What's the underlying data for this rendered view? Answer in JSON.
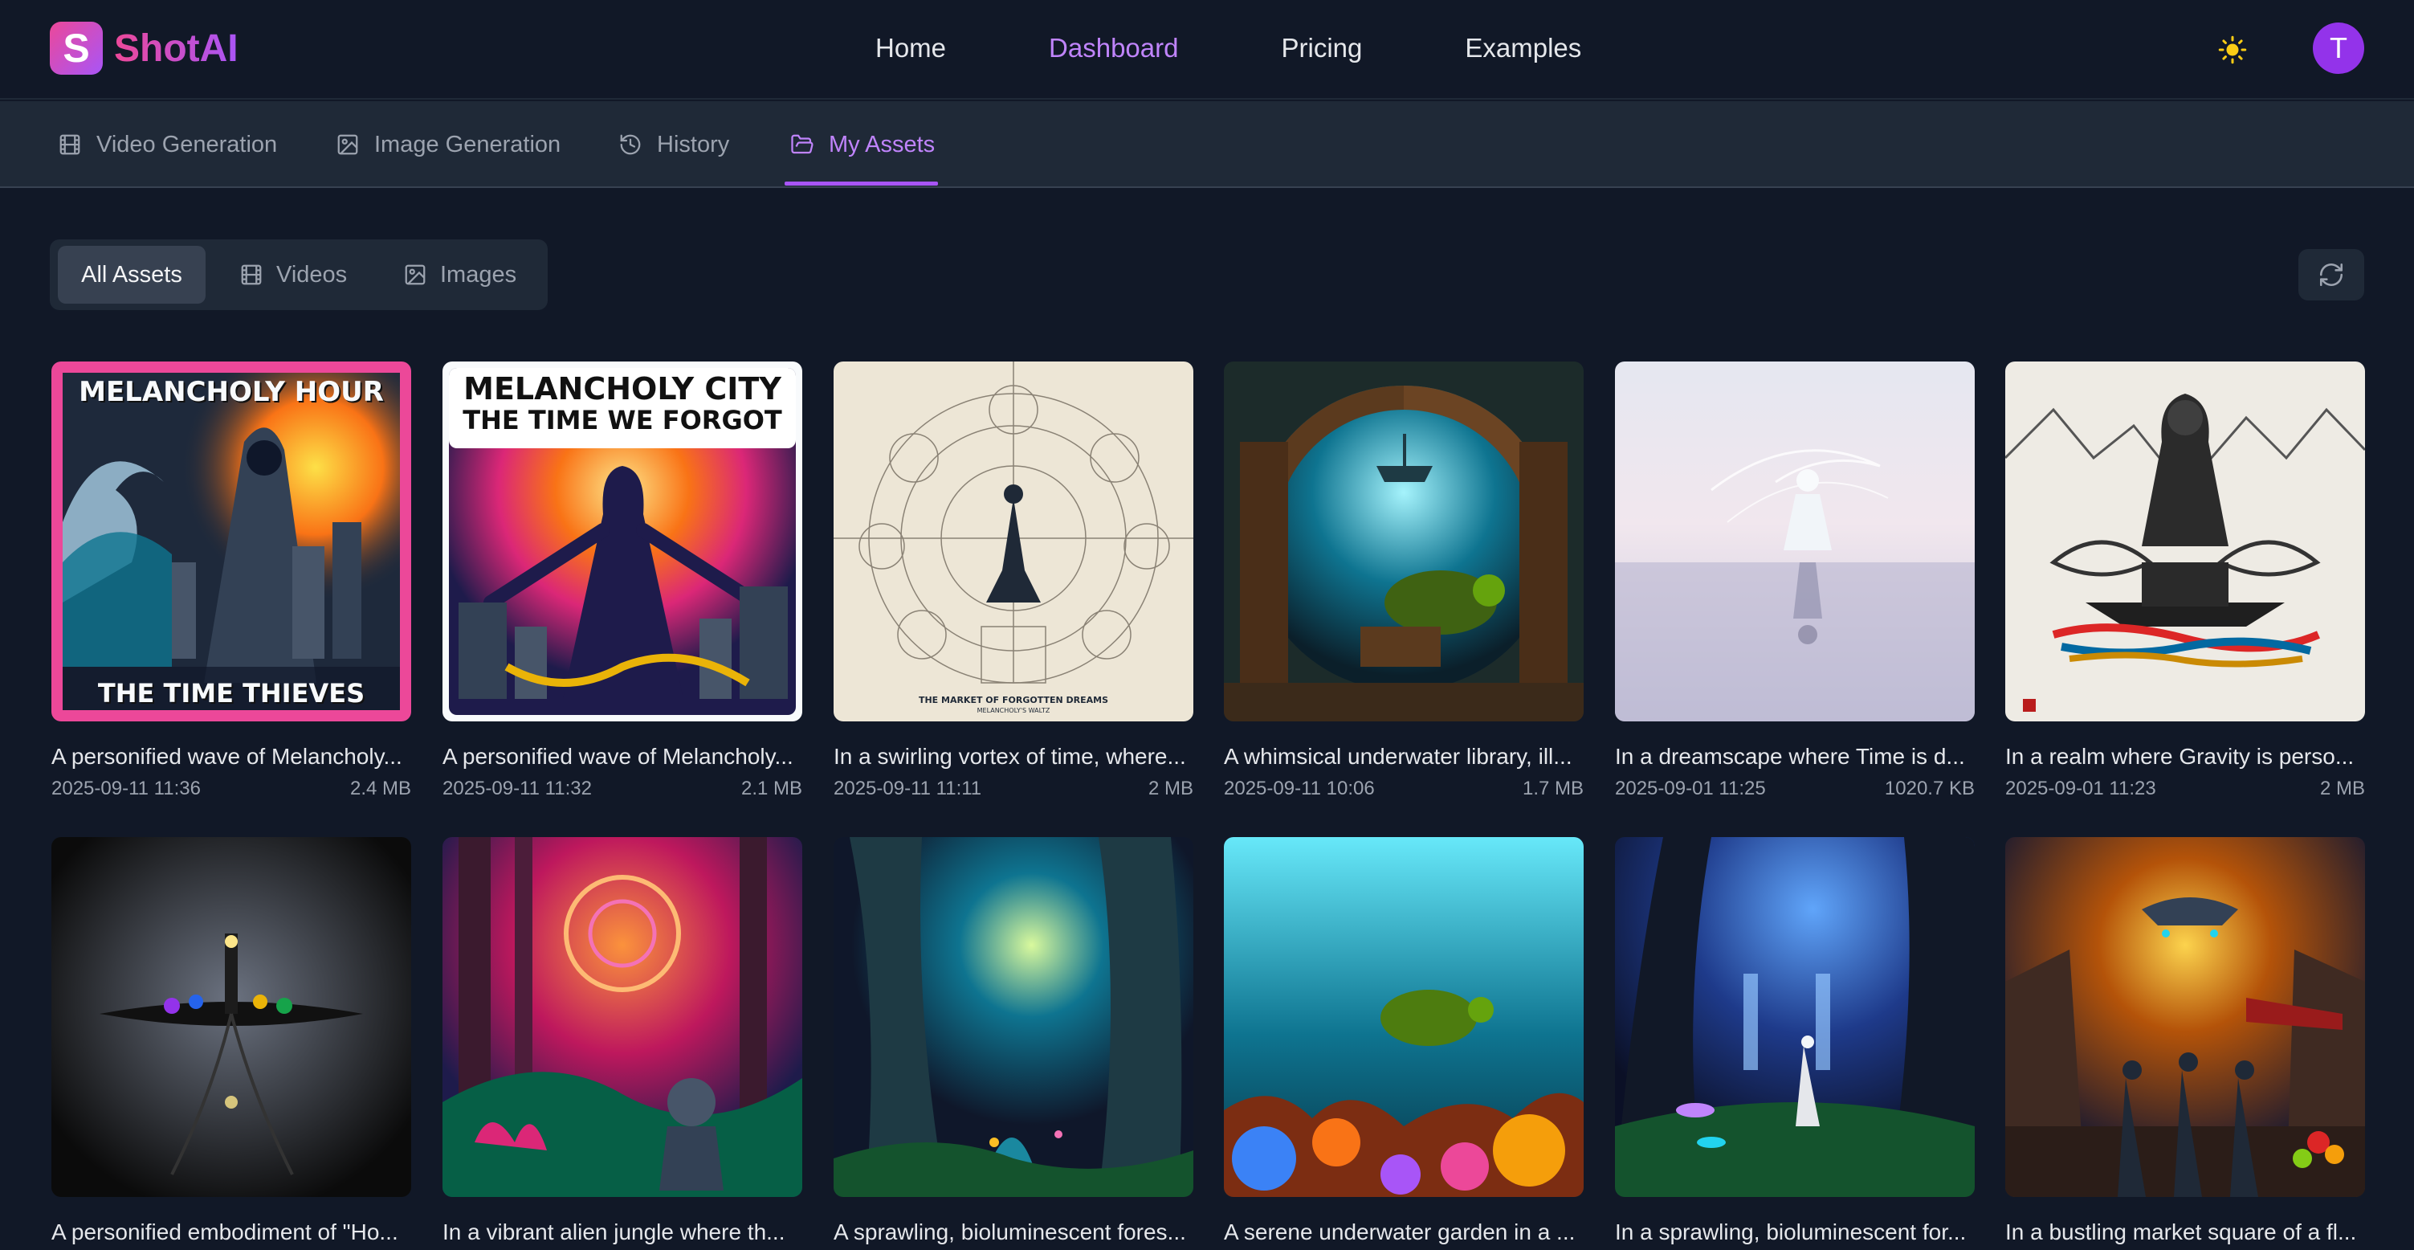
{
  "app": {
    "logo_letter": "S",
    "name": "ShotAI"
  },
  "nav": {
    "items": [
      {
        "label": "Home",
        "active": false
      },
      {
        "label": "Dashboard",
        "active": true
      },
      {
        "label": "Pricing",
        "active": false
      },
      {
        "label": "Examples",
        "active": false
      }
    ]
  },
  "user": {
    "avatar_initial": "T"
  },
  "subnav": {
    "items": [
      {
        "label": "Video Generation",
        "icon": "film-icon",
        "active": false
      },
      {
        "label": "Image Generation",
        "icon": "image-icon",
        "active": false
      },
      {
        "label": "History",
        "icon": "history-icon",
        "active": false
      },
      {
        "label": "My Assets",
        "icon": "folder-open-icon",
        "active": true
      }
    ]
  },
  "filters": {
    "items": [
      {
        "label": "All Assets",
        "active": true
      },
      {
        "label": "Videos",
        "icon": "film-icon",
        "active": false
      },
      {
        "label": "Images",
        "icon": "image-icon",
        "active": false
      }
    ]
  },
  "assets": [
    {
      "title": "A personified wave of Melancholy...",
      "date": "2025-09-11 11:36",
      "size": "2.4 MB",
      "poster_top": "MELANCHOLY HOUR",
      "poster_bottom": "THE TIME THIEVES"
    },
    {
      "title": "A personified wave of Melancholy...",
      "date": "2025-09-11 11:32",
      "size": "2.1 MB",
      "poster_top": "MELANCHOLY CITY",
      "poster_sub": "THE TIME WE FORGOT"
    },
    {
      "title": "In a swirling vortex of time, where...",
      "date": "2025-09-11 11:11",
      "size": "2 MB",
      "poster_caption": "THE MARKET OF FORGOTTEN DREAMS",
      "poster_caption_sub": "MELANCHOLY'S WALTZ"
    },
    {
      "title": "A whimsical underwater library, ill...",
      "date": "2025-09-11 10:06",
      "size": "1.7 MB"
    },
    {
      "title": "In a dreamscape where Time is d...",
      "date": "2025-09-01 11:25",
      "size": "1020.7 KB"
    },
    {
      "title": "In a realm where Gravity is perso...",
      "date": "2025-09-01 11:23",
      "size": "2 MB"
    },
    {
      "title": "A personified embodiment of \"Ho...",
      "date": "",
      "size": ""
    },
    {
      "title": "In a vibrant alien jungle where th...",
      "date": "",
      "size": ""
    },
    {
      "title": "A sprawling, bioluminescent fores...",
      "date": "",
      "size": ""
    },
    {
      "title": "A serene underwater garden in a ...",
      "date": "",
      "size": ""
    },
    {
      "title": "In a sprawling, bioluminescent for...",
      "date": "",
      "size": ""
    },
    {
      "title": "In a bustling market square of a fl...",
      "date": "",
      "size": ""
    }
  ],
  "colors": {
    "accent": "#a855f7",
    "accent_text": "#c084fc",
    "background": "#111827",
    "surface": "#1f2937"
  }
}
